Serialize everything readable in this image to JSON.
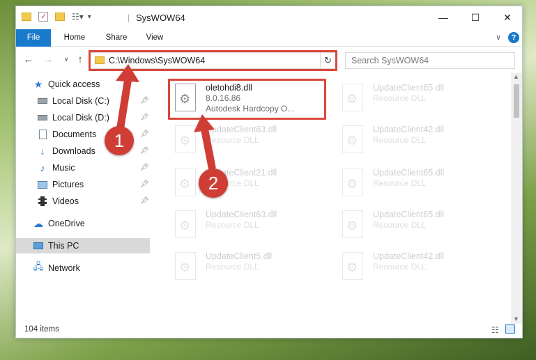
{
  "window": {
    "title": "SysWOW64",
    "controls": {
      "minimize": "—",
      "maximize": "☐",
      "close": "✕"
    }
  },
  "ribbon": {
    "tabs": [
      "File",
      "Home",
      "Share",
      "View"
    ]
  },
  "address": {
    "path": "C:\\Windows\\SysWOW64"
  },
  "search": {
    "placeholder": "Search SysWOW64"
  },
  "navpane": {
    "quick_access": "Quick access",
    "items": [
      "Local Disk (C:)",
      "Local Disk (D:)",
      "Documents",
      "Downloads",
      "Music",
      "Pictures",
      "Videos"
    ],
    "onedrive": "OneDrive",
    "this_pc": "This PC",
    "network": "Network"
  },
  "files": [
    {
      "name": "oletohdi8.dll",
      "sub1": "8.0.16.86",
      "sub2": "Autodesk Hardcopy O..."
    },
    {
      "name": "UpdateClient65.dll",
      "sub1": "Resource DLL"
    },
    {
      "name": "UpdateClient63.dll",
      "sub1": "Resource DLL"
    },
    {
      "name": "UpdateClient42.dll",
      "sub1": "Resource DLL"
    },
    {
      "name": "UpdateClient21.dll",
      "sub1": "Resource DLL"
    },
    {
      "name": "UpdateClient65.dll",
      "sub1": "Resource DLL"
    },
    {
      "name": "UpdateClient63.dll",
      "sub1": "Resource DLL"
    },
    {
      "name": "UpdateClient65.dll",
      "sub1": "Resource DLL"
    },
    {
      "name": "UpdateClient5.dll",
      "sub1": "Resource DLL"
    },
    {
      "name": "UpdateClient42.dll",
      "sub1": "Resource DLL"
    }
  ],
  "status": {
    "count": "104 items"
  },
  "annotations": {
    "one": "1",
    "two": "2"
  },
  "colors": {
    "accent": "#1979ca",
    "highlight": "#d9483b",
    "badge": "#cf3d35"
  }
}
